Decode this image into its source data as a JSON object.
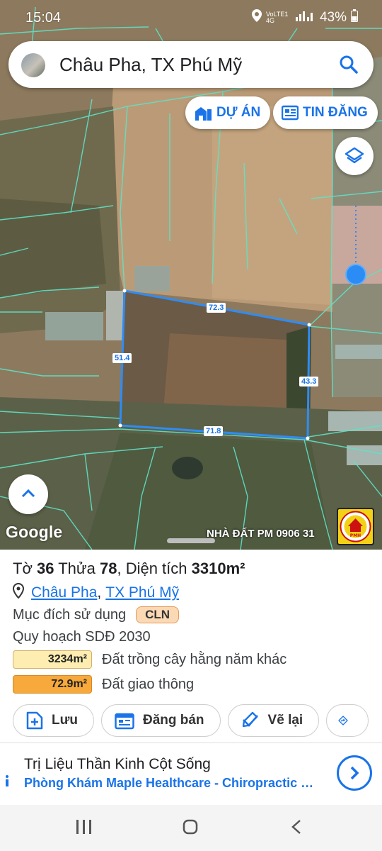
{
  "status_bar": {
    "time": "15:04",
    "network": "VoLTE1 4G",
    "battery": "43%"
  },
  "search": {
    "query": "Châu Pha, TX Phú Mỹ"
  },
  "map_buttons": {
    "du_an": "DỰ ÁN",
    "tin_dang": "TIN ĐĂNG"
  },
  "map": {
    "segments": [
      "72.3",
      "51.4",
      "43.3",
      "71.8"
    ],
    "attribution": "Google",
    "watermark": "NHÀ ĐẤT PM 0906 31",
    "logo_text": "PMH"
  },
  "parcel": {
    "to_label": "Tờ",
    "to": "36",
    "thua_label": "Thửa",
    "thua": "78",
    "dt_label": "Diện tích",
    "dien_tich": "3310m²",
    "ward": "Châu Pha",
    "town": "TX Phú Mỹ",
    "purpose_label": "Mục đích sử dụng",
    "purpose_code": "CLN",
    "plan_label": "Quy hoạch SDĐ 2030",
    "areas": [
      {
        "value": "3234m²",
        "label": "Đất trồng cây hằng năm khác",
        "color": "#fdedb0"
      },
      {
        "value": "72.9m²",
        "label": "Đất giao thông",
        "color": "#f7a93b"
      }
    ]
  },
  "actions": {
    "save": "Lưu",
    "post": "Đăng bán",
    "redraw": "Vẽ lại"
  },
  "ad": {
    "title": "Trị Liệu Thần Kinh Cột Sống",
    "subtitle": "Phòng Khám Maple Healthcare - Chiropractic Singapore"
  },
  "colors": {
    "accent": "#1a73e8",
    "parcel_line": "#2f8cf4",
    "grid_line": "#5fe3c8"
  }
}
